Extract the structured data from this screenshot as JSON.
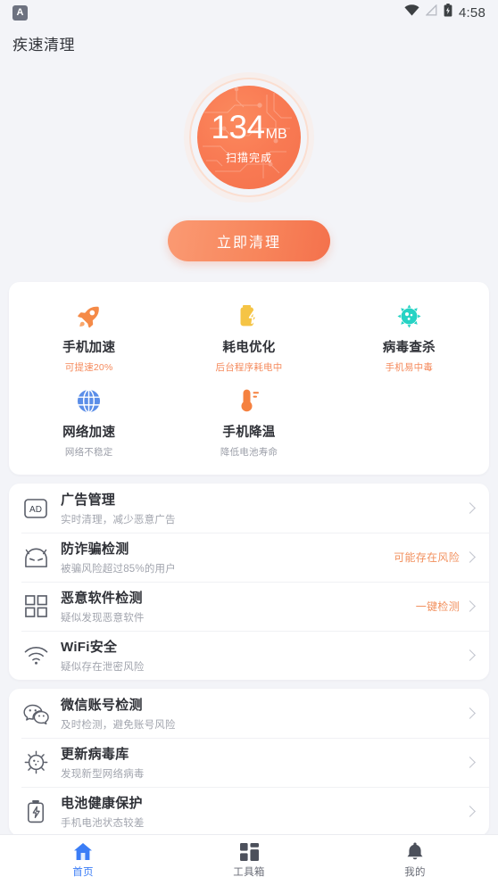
{
  "statusbar": {
    "app_badge": "A",
    "time": "4:58",
    "icons": [
      "wifi-icon",
      "signal-icon",
      "battery-icon"
    ]
  },
  "header": {
    "title": "疾速清理"
  },
  "scan": {
    "amount": "134",
    "unit": "MB",
    "status": "扫描完成",
    "accent": "#f4714c"
  },
  "cta": {
    "label": "立即清理"
  },
  "features": [
    {
      "name": "手机加速",
      "sub": "可提速20%",
      "sub_style": "warn",
      "icon": "rocket-icon",
      "color": "#f58a47"
    },
    {
      "name": "耗电优化",
      "sub": "后台程序耗电中",
      "sub_style": "warn",
      "icon": "battery-bolt-icon",
      "color": "#f5c445"
    },
    {
      "name": "病毒查杀",
      "sub": "手机易中毒",
      "sub_style": "warn",
      "icon": "virus-icon",
      "color": "#25d3c4"
    },
    {
      "name": "网络加速",
      "sub": "网络不稳定",
      "sub_style": "mute",
      "icon": "globe-icon",
      "color": "#5b8ee8"
    },
    {
      "name": "手机降温",
      "sub": "降低电池寿命",
      "sub_style": "mute",
      "icon": "thermometer-icon",
      "color": "#f5813f"
    }
  ],
  "list_one": [
    {
      "title": "广告管理",
      "sub": "实时清理，减少恶意广告",
      "status": "",
      "icon": "ad-icon"
    },
    {
      "title": "防诈骗检测",
      "sub": "被骗风险超过85%的用户",
      "status": "可能存在风险",
      "icon": "robot-face-icon"
    },
    {
      "title": "恶意软件检测",
      "sub": "疑似发现恶意软件",
      "status": "一键检测",
      "icon": "grid-squares-icon"
    },
    {
      "title": "WiFi安全",
      "sub": "疑似存在泄密风险",
      "status": "",
      "icon": "wifi-icon"
    }
  ],
  "list_two": [
    {
      "title": "微信账号检测",
      "sub": "及时检测，避免账号风险",
      "status": "",
      "icon": "wechat-icon"
    },
    {
      "title": "更新病毒库",
      "sub": "发现新型网络病毒",
      "status": "",
      "icon": "virus-outline-icon"
    },
    {
      "title": "电池健康保护",
      "sub": "手机电池状态较差",
      "status": "",
      "icon": "battery-health-icon"
    }
  ],
  "tabs": [
    {
      "label": "首页",
      "icon": "home-icon",
      "active": true
    },
    {
      "label": "工具箱",
      "icon": "toolbox-grid-icon",
      "active": false
    },
    {
      "label": "我的",
      "icon": "bell-icon",
      "active": false
    }
  ]
}
